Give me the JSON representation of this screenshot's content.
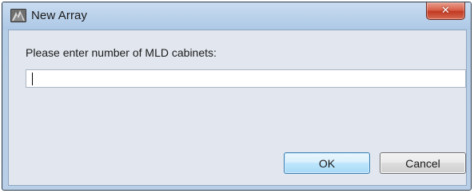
{
  "window": {
    "title": "New Array",
    "app_icon": "app-icon",
    "close_icon": "close-icon",
    "close_glyph": "✕"
  },
  "form": {
    "prompt": "Please enter number of MLD cabinets:",
    "input_value": "",
    "input_placeholder": ""
  },
  "buttons": {
    "ok_label": "OK",
    "cancel_label": "Cancel"
  },
  "colors": {
    "title_bar": "#b3cbe6",
    "client_bg": "#e2e7ef",
    "close_button": "#c94a33",
    "ok_border": "#3c7fb1"
  }
}
